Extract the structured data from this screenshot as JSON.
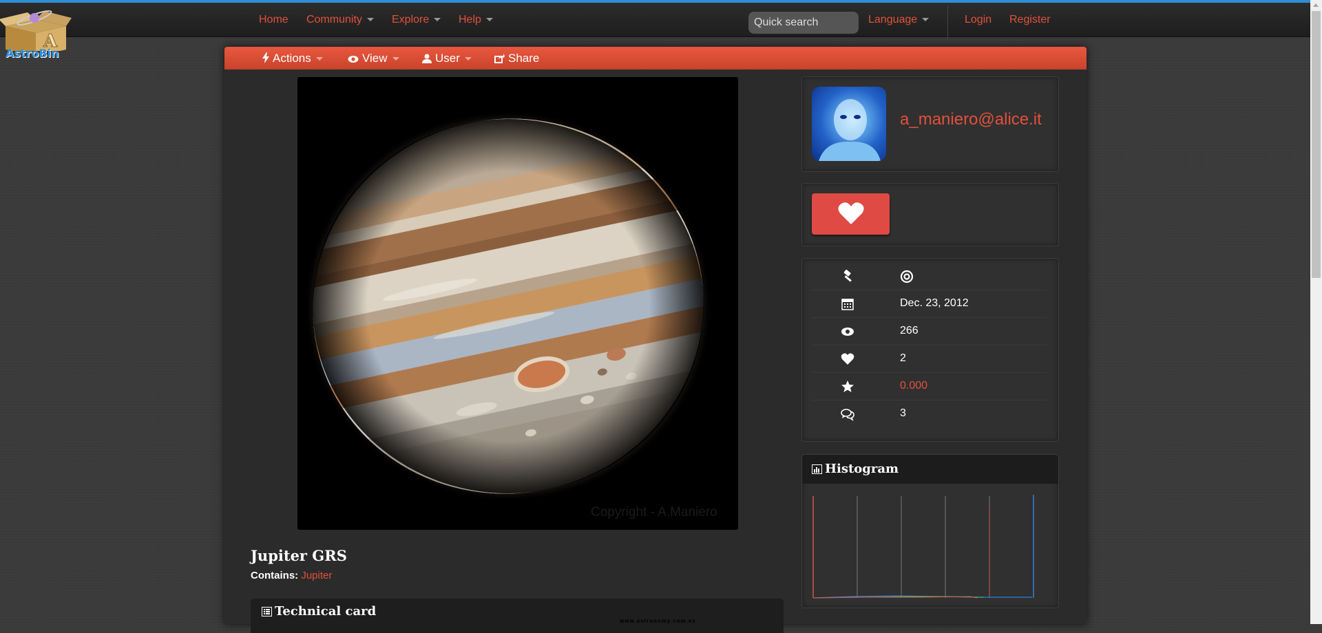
{
  "brand": {
    "name": "AstroBin"
  },
  "nav": {
    "home": "Home",
    "community": "Community",
    "explore": "Explore",
    "help": "Help",
    "search_placeholder": "Quick search",
    "language": "Language",
    "login": "Login",
    "register": "Register"
  },
  "subnav": {
    "actions": "Actions",
    "view": "View",
    "user": "User",
    "share": "Share"
  },
  "image": {
    "subject": "Jupiter",
    "watermark": "Copyright - A.Maniero",
    "title": "Jupiter GRS",
    "contains_label": "Contains:",
    "contains_value": "Jupiter"
  },
  "technical_card": {
    "title": "Technical card",
    "fine_print": "www.astronomy.com.es"
  },
  "user": {
    "username": "a_maniero@alice.it"
  },
  "stats": [
    {
      "icon": "gavel-icon",
      "value": ""
    },
    {
      "icon": "calendar-icon",
      "value": "Dec. 23, 2012"
    },
    {
      "icon": "eye-icon",
      "value": "266"
    },
    {
      "icon": "heart-icon",
      "value": "2"
    },
    {
      "icon": "star-icon",
      "value": "0.000"
    },
    {
      "icon": "comments-icon",
      "value": "3"
    }
  ],
  "histogram": {
    "title": "Histogram",
    "channels": [
      {
        "name": "red",
        "color": "#d9534f"
      },
      {
        "name": "green",
        "color": "#5cb85c"
      },
      {
        "name": "blue",
        "color": "#2f7fd6"
      }
    ]
  },
  "colors": {
    "accent": "#e2513b",
    "like_button": "#df4a44",
    "brand_blue": "#2e8fd8"
  }
}
